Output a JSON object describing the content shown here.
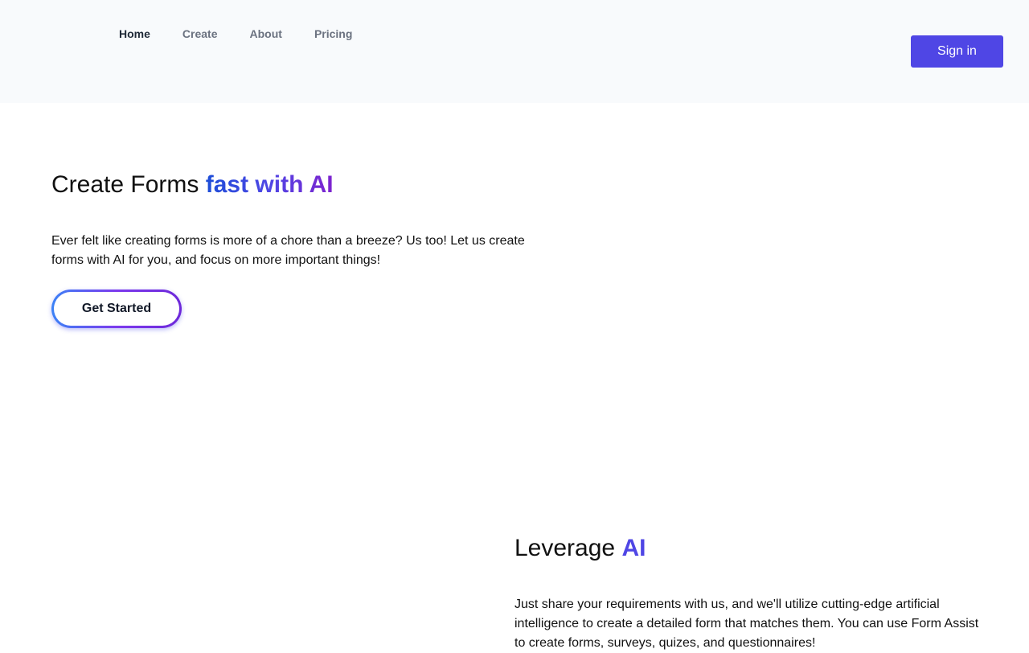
{
  "header": {
    "nav": [
      {
        "label": "Home",
        "active": true
      },
      {
        "label": "Create",
        "active": false
      },
      {
        "label": "About",
        "active": false
      },
      {
        "label": "Pricing",
        "active": false
      }
    ],
    "signin_label": "Sign in"
  },
  "hero": {
    "title_plain": "Create Forms ",
    "title_highlight": "fast with AI",
    "description": "Ever felt like creating forms is more of a chore than a breeze? Us too! Let us create forms with AI for you, and focus on more important things!",
    "cta_label": "Get Started"
  },
  "features": {
    "title_plain": "Leverage ",
    "title_highlight": "AI",
    "description": "Just share your requirements with us, and we'll utilize cutting-edge artificial intelligence to create a detailed form that matches them. You can use Form Assist to create forms, surveys, quizes, and questionnaires!"
  },
  "colors": {
    "header_bg": "#f8fafc",
    "accent": "#4f46e5",
    "gradient_start": "#1d4ed8",
    "gradient_end": "#7e22ce"
  }
}
